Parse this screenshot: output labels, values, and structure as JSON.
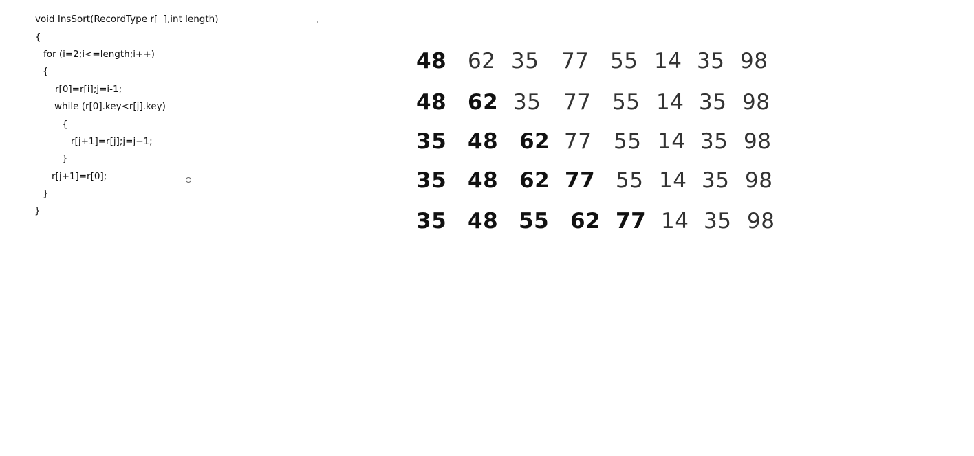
{
  "code": {
    "lines": [
      "void InsSort(RecordType r[  ],int length)",
      "{",
      "for (i=2;i<=length;i++)",
      "{",
      "r[0]=r[i];j=i-1;",
      "while (r[0].key<r[j].key)",
      "{",
      "r[j+1]=r[j];j=j−1;",
      "}",
      "r[j+1]=r[0];",
      "}",
      "}"
    ]
  },
  "sort_table": {
    "rows": [
      {
        "values": [
          "48",
          "62",
          "35",
          "77",
          "55",
          "14",
          "35",
          "98"
        ],
        "bold": [
          true,
          false,
          false,
          false,
          false,
          false,
          false,
          false
        ]
      },
      {
        "values": [
          "48",
          "62",
          "35",
          "77",
          "55",
          "14",
          "35",
          "98"
        ],
        "bold": [
          true,
          true,
          false,
          false,
          false,
          false,
          false,
          false
        ]
      },
      {
        "values": [
          "35",
          "48",
          "62",
          "77",
          "55",
          "14",
          "35",
          "98"
        ],
        "bold": [
          true,
          true,
          true,
          false,
          false,
          false,
          false,
          false
        ]
      },
      {
        "values": [
          "35",
          "48",
          "62",
          "77",
          "55",
          "14",
          "35",
          "98"
        ],
        "bold": [
          true,
          true,
          true,
          true,
          false,
          false,
          false,
          false
        ]
      },
      {
        "values": [
          "35",
          "48",
          "55",
          "62",
          "77",
          "14",
          "35",
          "98"
        ],
        "bold": [
          true,
          true,
          true,
          true,
          true,
          false,
          false,
          false
        ]
      }
    ]
  }
}
